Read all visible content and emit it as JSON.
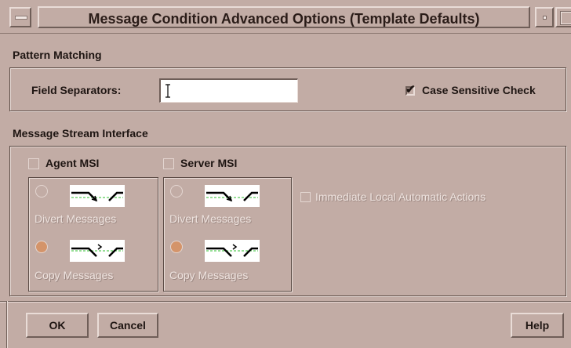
{
  "window": {
    "title": "Message Condition Advanced Options (Template Defaults)",
    "icons": {
      "menu": "window-menu-icon",
      "minimize": "minimize-icon",
      "maximize": "maximize-icon"
    }
  },
  "pattern_matching": {
    "heading": "Pattern Matching",
    "field_separators_label": "Field Separators:",
    "field_separators_value": "",
    "case_sensitive_label": "Case Sensitive Check",
    "case_sensitive_checked": true
  },
  "msi": {
    "heading": "Message Stream Interface",
    "agent": {
      "label": "Agent MSI",
      "checked": false,
      "divert_label": "Divert Messages",
      "copy_label": "Copy Messages",
      "selected": "copy"
    },
    "server": {
      "label": "Server MSI",
      "checked": false,
      "divert_label": "Divert Messages",
      "copy_label": "Copy Messages",
      "selected": "copy"
    },
    "immediate_label": "Immediate Local Automatic Actions",
    "immediate_checked": false
  },
  "buttons": {
    "ok": "OK",
    "cancel": "Cancel",
    "help": "Help"
  },
  "colors": {
    "background": "#c2aca5",
    "radio_selected": "#d4946a",
    "diagram_line": "#000000",
    "diagram_dashed": "#2fbf2f"
  }
}
